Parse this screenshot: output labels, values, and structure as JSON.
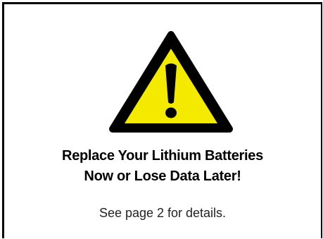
{
  "notice": {
    "icon": "warning-triangle-icon",
    "headline_line1": "Replace Your Lithium Batteries",
    "headline_line2": "Now or Lose Data Later!",
    "details": "See page 2 for details."
  },
  "colors": {
    "triangle_fill": "#f4ea00",
    "outline": "#000000",
    "text": "#000000"
  }
}
